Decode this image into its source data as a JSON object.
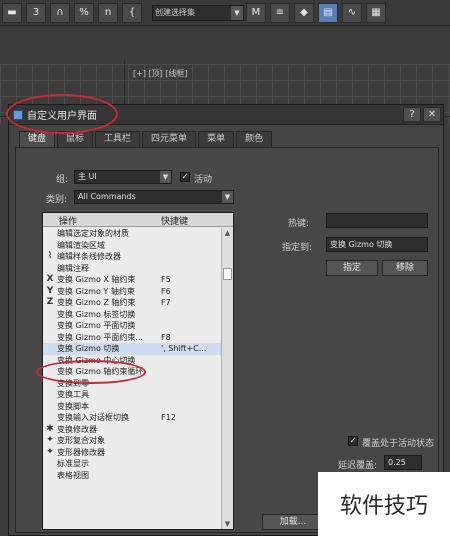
{
  "toolbar": {
    "buttons": [
      "▬",
      "3",
      "∩",
      "%",
      "n",
      "{"
    ],
    "selection_set": "创建选择集",
    "right_buttons": [
      "M",
      "≡",
      "◆",
      "▤",
      "∿",
      "▦"
    ]
  },
  "viewport": {
    "label": "[+] [顶] [线框]"
  },
  "dialog": {
    "title": "自定义用户界面",
    "help_label": "?",
    "close_label": "✕",
    "tabs": [
      "键盘",
      "鼠标",
      "工具栏",
      "四元菜单",
      "菜单",
      "颜色"
    ],
    "active_tab_index": 0,
    "group_label": "组:",
    "group_value": "主 UI",
    "active_label": "活动",
    "active_checked": true,
    "category_label": "类别:",
    "category_value": "All Commands",
    "list": {
      "col_action": "操作",
      "col_shortcut": "快捷键",
      "rows": [
        {
          "icon": "",
          "name": "编辑选定对象的材质",
          "shortcut": ""
        },
        {
          "icon": "",
          "name": "编辑渲染区域",
          "shortcut": ""
        },
        {
          "icon": "⌇",
          "name": "编辑样条线修改器",
          "shortcut": ""
        },
        {
          "icon": "",
          "name": "编辑注释",
          "shortcut": ""
        },
        {
          "icon": "X",
          "name": "变换 Gizmo X 轴约束",
          "shortcut": "F5"
        },
        {
          "icon": "Y",
          "name": "变换 Gizmo Y 轴约束",
          "shortcut": "F6"
        },
        {
          "icon": "Z",
          "name": "变换 Gizmo Z 轴约束",
          "shortcut": "F7"
        },
        {
          "icon": "",
          "name": "变换 Gizmo 标签切换",
          "shortcut": ""
        },
        {
          "icon": "",
          "name": "变换 Gizmo 平面切换",
          "shortcut": ""
        },
        {
          "icon": "",
          "name": "变换 Gizmo 平面约束...",
          "shortcut": "F8"
        },
        {
          "icon": "",
          "name": "变换 Gizmo 切换",
          "shortcut": "', Shift+C..."
        },
        {
          "icon": "",
          "name": "变换 Gizmo 中心切换",
          "shortcut": ""
        },
        {
          "icon": "",
          "name": "变换 Gizmo 轴约束循环",
          "shortcut": ""
        },
        {
          "icon": "",
          "name": "变换到零",
          "shortcut": ""
        },
        {
          "icon": "",
          "name": "变换工具",
          "shortcut": ""
        },
        {
          "icon": "",
          "name": "变换脚本",
          "shortcut": ""
        },
        {
          "icon": "",
          "name": "变换输入对话框切换",
          "shortcut": "F12"
        },
        {
          "icon": "✱",
          "name": "变换修改器",
          "shortcut": ""
        },
        {
          "icon": "✦",
          "name": "变形复合对象",
          "shortcut": ""
        },
        {
          "icon": "✦",
          "name": "变形器修改器",
          "shortcut": ""
        },
        {
          "icon": "",
          "name": "标准显示",
          "shortcut": ""
        },
        {
          "icon": "",
          "name": "表格视图",
          "shortcut": ""
        }
      ],
      "selected_index": 10
    },
    "hotkey_label": "热键:",
    "hotkey_value": "",
    "assigned_label": "指定到:",
    "assigned_value": "变换 Gizmo 切换",
    "assign_button": "指定",
    "remove_button": "移除",
    "override_label": "覆盖处于活动状态",
    "override_checked": true,
    "delay_label": "延迟覆盖:",
    "delay_value": "0.25",
    "load_button": "加载..."
  },
  "watermark": "软件技巧",
  "colors": {
    "annotation": "#c8283a",
    "accent": "#5a7fb8"
  }
}
